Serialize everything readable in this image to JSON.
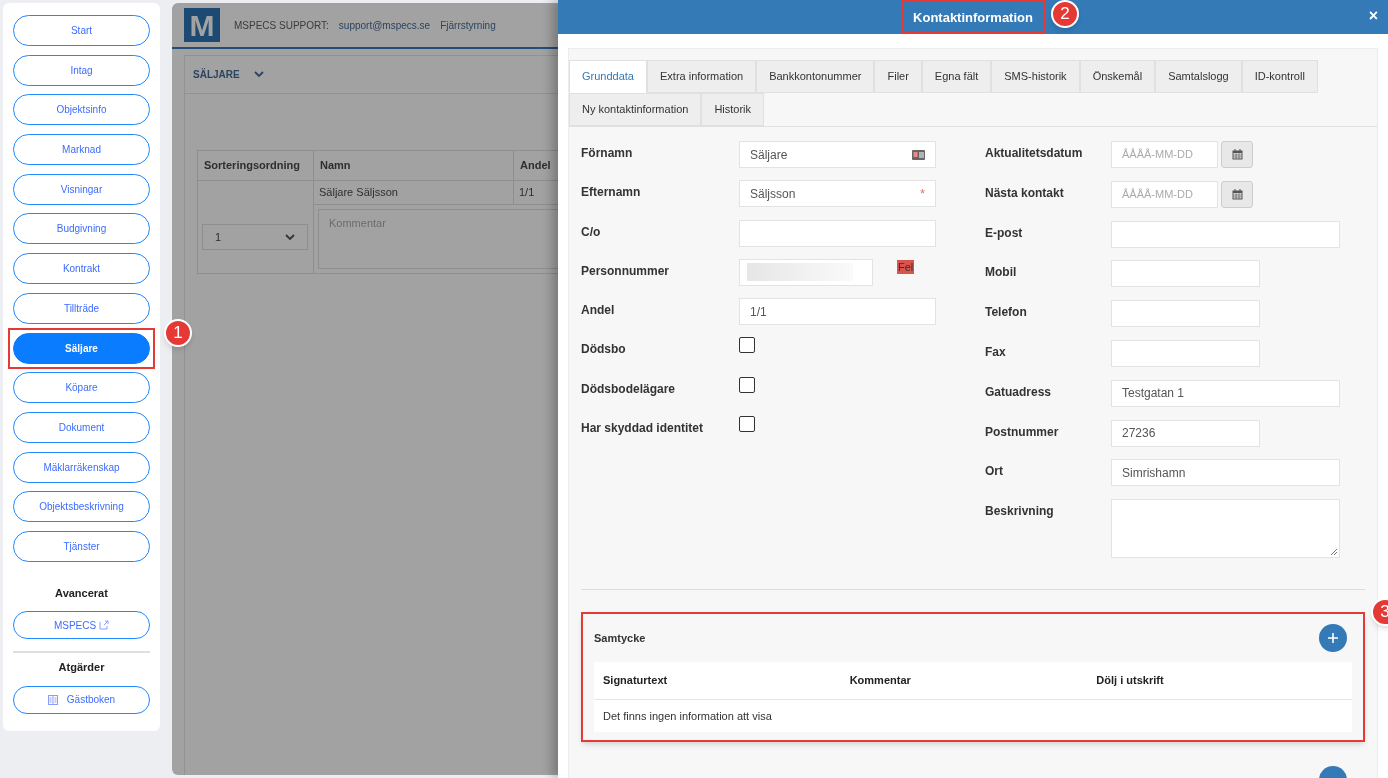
{
  "sidebar": {
    "items": [
      {
        "label": "Start",
        "selected": false
      },
      {
        "label": "Intag",
        "selected": false
      },
      {
        "label": "Objektsinfo",
        "selected": false
      },
      {
        "label": "Marknad",
        "selected": false
      },
      {
        "label": "Visningar",
        "selected": false
      },
      {
        "label": "Budgivning",
        "selected": false
      },
      {
        "label": "Kontrakt",
        "selected": false
      },
      {
        "label": "Tillträde",
        "selected": false
      },
      {
        "label": "Säljare",
        "selected": true,
        "callout": "1"
      },
      {
        "label": "Köpare",
        "selected": false
      },
      {
        "label": "Dokument",
        "selected": false
      },
      {
        "label": "Mäklarräkenskap",
        "selected": false
      },
      {
        "label": "Objektsbeskrivning",
        "selected": false
      },
      {
        "label": "Tjänster",
        "selected": false
      }
    ],
    "advanced": {
      "heading": "Avancerat",
      "button": "MSPECS"
    },
    "actions": {
      "heading": "Atgärder",
      "button": "Gästboken"
    }
  },
  "background": {
    "logo": "M",
    "support_label": "MSPECS SUPPORT:",
    "support_email": "support@mspecs.se",
    "remote_link": "Fjärrstyrning",
    "section": "SÄLJARE",
    "table": {
      "columns": [
        "Sorteringsordning",
        "Namn",
        "Andel"
      ],
      "order": "1",
      "name": "Säljare Säljsson",
      "share": "1/1",
      "comment_placeholder": "Kommentar"
    }
  },
  "modal": {
    "title": "Kontaktinformation",
    "title_callout": "2",
    "close": "×",
    "tabs": [
      {
        "label": "Grunddata",
        "selected": true
      },
      {
        "label": "Extra information",
        "selected": false
      },
      {
        "label": "Bankkontonummer",
        "selected": false
      },
      {
        "label": "Filer",
        "selected": false
      },
      {
        "label": "Egna fält",
        "selected": false
      },
      {
        "label": "SMS-historik",
        "selected": false
      },
      {
        "label": "Önskemål",
        "selected": false
      },
      {
        "label": "Samtalslogg",
        "selected": false
      },
      {
        "label": "ID-kontroll",
        "selected": false
      },
      {
        "label": "Ny kontaktinformation",
        "selected": false
      },
      {
        "label": "Historik",
        "selected": false
      }
    ],
    "left_fields": [
      {
        "label": "Förnamn",
        "kind": "card",
        "value": "Säljare"
      },
      {
        "label": "Efternamn",
        "kind": "text",
        "value": "Säljsson",
        "marker": "*"
      },
      {
        "label": "C/o",
        "kind": "text"
      },
      {
        "label": "Personnummer",
        "kind": "redacted",
        "error": "Fel"
      },
      {
        "label": "Andel",
        "kind": "text",
        "value": "1/1"
      },
      {
        "label": "Dödsbo",
        "kind": "checkbox",
        "checked": false
      },
      {
        "label": "Dödsbodelägare",
        "kind": "checkbox",
        "checked": false
      },
      {
        "label": "Har skyddad identitet",
        "kind": "checkbox",
        "checked": false
      }
    ],
    "right_fields": [
      {
        "label": "Aktualitetsdatum",
        "kind": "date",
        "placeholder": "ÅÅÅÅ-MM-DD"
      },
      {
        "label": "Nästa kontakt",
        "kind": "date",
        "placeholder": "ÅÅÅÅ-MM-DD"
      },
      {
        "label": "E-post",
        "kind": "text"
      },
      {
        "label": "Mobil",
        "kind": "phone"
      },
      {
        "label": "Telefon",
        "kind": "phone"
      },
      {
        "label": "Fax",
        "kind": "phone"
      },
      {
        "label": "Gatuadress",
        "kind": "text",
        "value": "Testgatan 1"
      },
      {
        "label": "Postnummer",
        "kind": "postcode",
        "value": "27236"
      },
      {
        "label": "Ort",
        "kind": "text",
        "value": "Simrishamn"
      },
      {
        "label": "Beskrivning",
        "kind": "textarea"
      }
    ],
    "consent": {
      "title": "Samtycke",
      "callout": "3",
      "columns": [
        "Signaturtext",
        "Kommentar",
        "Dölj i utskrift"
      ],
      "empty_text": "Det finns ingen information att visa"
    }
  }
}
